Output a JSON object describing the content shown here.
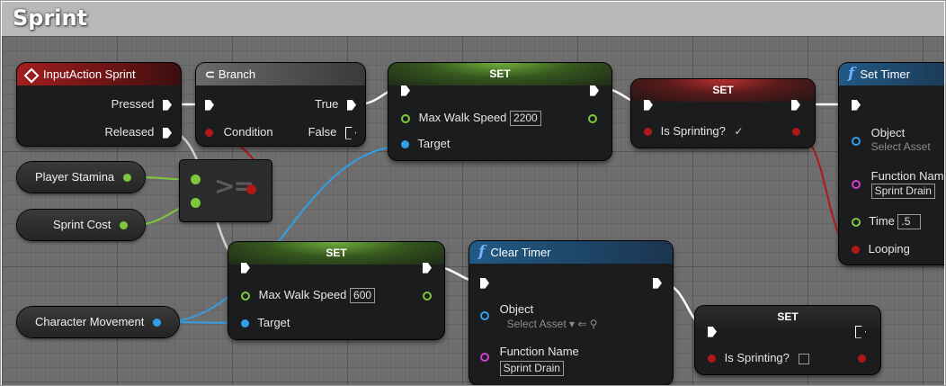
{
  "comment": {
    "title": "Sprint"
  },
  "nodes": {
    "input_action": {
      "title": "InputAction Sprint",
      "pressed": "Pressed",
      "released": "Released"
    },
    "branch": {
      "title": "Branch",
      "condition": "Condition",
      "true_label": "True",
      "false_label": "False"
    },
    "set_speed_top": {
      "title": "SET",
      "max_walk_speed": "Max Walk Speed",
      "value": "2200",
      "target": "Target"
    },
    "set_sprinting_true": {
      "title": "SET",
      "is_sprinting": "Is Sprinting?",
      "checked": "✓"
    },
    "set_timer": {
      "title": "Set Timer",
      "object": "Object",
      "object_placeholder": "Select Asset",
      "function_name": "Function Nam",
      "function_value": "Sprint Drain",
      "time": "Time",
      "time_value": ".5",
      "looping": "Looping"
    },
    "player_stamina": {
      "label": "Player Stamina"
    },
    "sprint_cost": {
      "label": "Sprint Cost"
    },
    "compare": {
      "symbol": ">="
    },
    "set_speed_bottom": {
      "title": "SET",
      "max_walk_speed": "Max Walk Speed",
      "value": "600",
      "target": "Target"
    },
    "clear_timer": {
      "title": "Clear Timer",
      "object": "Object",
      "object_placeholder": "Select Asset",
      "function_name": "Function Name",
      "function_value": "Sprint Drain"
    },
    "set_sprinting_false": {
      "title": "SET",
      "is_sprinting": "Is Sprinting?"
    },
    "character_movement": {
      "label": "Character Movement"
    }
  },
  "colors": {
    "exec": "#ffffff",
    "float": "#7ec83e",
    "object": "#2fa0e8",
    "bool": "#b01818",
    "delegate": "#d040d0",
    "event_header": "#a11e1e",
    "function_header": "#215a86"
  }
}
